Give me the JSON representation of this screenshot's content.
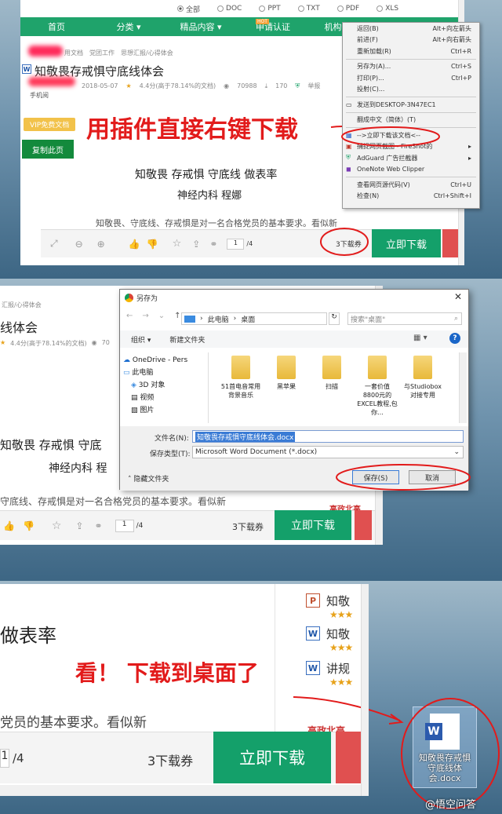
{
  "panel1": {
    "formats": [
      "全部",
      "DOC",
      "PPT",
      "TXT",
      "PDF",
      "XLS"
    ],
    "nav": [
      "首页",
      "分类 ▾",
      "精品内容 ▾",
      "申请认证",
      "机构合作 ▾"
    ],
    "hot_badge": "HOT",
    "breadcrumb": [
      "用文档",
      "党团工作",
      "思想汇报/心得体会"
    ],
    "doc_title": "知敬畏存戒惧守底线体会",
    "date": "2018-05-07",
    "rating": "4.4分(高于78.14%的文档)",
    "views": "70988",
    "downloads": "170",
    "report": "举报",
    "phone_read": "手机阅",
    "vip_label": "VIP免费文档",
    "copy_button": "复制此页",
    "content_title": "知敬畏 存戒惧 守底线 做表率",
    "author": "神经内科 程娜",
    "body_text": "知敬畏、守底线、存戒惧是对一名合格党员的基本要求。看似新",
    "page_current": "1",
    "page_total": "/4",
    "download_ticket": "3下载券",
    "download_now": "立即下载",
    "annotation": "用插件直接右键下载"
  },
  "context_menu": {
    "items": [
      {
        "label": "返回(B)",
        "shortcut": "Alt+向左箭头"
      },
      {
        "label": "前进(F)",
        "shortcut": "Alt+向右箭头"
      },
      {
        "label": "重新加载(R)",
        "shortcut": "Ctrl+R"
      },
      {
        "sep": true
      },
      {
        "label": "另存为(A)...",
        "shortcut": "Ctrl+S"
      },
      {
        "label": "打印(P)...",
        "shortcut": "Ctrl+P"
      },
      {
        "label": "投射(C)...",
        "shortcut": ""
      },
      {
        "sep": true
      },
      {
        "label": "发送到DESKTOP-3N47EC1",
        "shortcut": ""
      },
      {
        "sep": true
      },
      {
        "label": "翻成中文（简体）(T)",
        "shortcut": ""
      },
      {
        "sep": true
      },
      {
        "label": "-->立即下载该文档<--",
        "shortcut": ""
      },
      {
        "label": "捕捉网页截图 - FireShot的",
        "shortcut": "▸"
      },
      {
        "label": "AdGuard 广告拦截器",
        "shortcut": "▸"
      },
      {
        "label": "OneNote Web Clipper",
        "shortcut": ""
      },
      {
        "sep": true
      },
      {
        "label": "查看网页源代码(V)",
        "shortcut": "Ctrl+U"
      },
      {
        "label": "检查(N)",
        "shortcut": "Ctrl+Shift+I"
      }
    ]
  },
  "panel2": {
    "breadcrumb": "汇报/心得体会",
    "doc_title_partial": "线体会",
    "rating": "4.4分(高于78.14%的文档)",
    "views_partial": "70",
    "content_title_partial": "知敬畏 存戒惧 守底",
    "author_partial": "神经内科 程",
    "body_partial": "守底线、存戒惧是对一名合格党员的基本要求。看似新",
    "side_text": "高政北高",
    "page_current": "1",
    "page_total": "/4",
    "download_ticket": "3下载券",
    "download_now": "立即下载"
  },
  "save_dialog": {
    "title": "另存为",
    "path": [
      "此电脑",
      "桌面"
    ],
    "search_placeholder": "搜索\"桌面\"",
    "organize": "组织 ▾",
    "new_folder": "新建文件夹",
    "sidebar": [
      "OneDrive - Pers",
      "此电脑",
      "3D 对象",
      "视频",
      "图片"
    ],
    "files": [
      "51首电音常用背景音乐",
      "黑苹果",
      "扫描",
      "一套价值8800元的EXCEL教程,包你...",
      "与Studiobox对接专用"
    ],
    "filename_label": "文件名(N):",
    "filename": "知敬畏存戒惧守底线体会.docx",
    "filetype_label": "保存类型(T):",
    "filetype": "Microsoft Word Document (*.docx)",
    "hide_folders": "隐藏文件夹",
    "save": "保存(S)",
    "cancel": "取消"
  },
  "panel3": {
    "content_partial": "做表率",
    "body_partial": "党员的基本要求。看似新",
    "side_docs": [
      "知敬",
      "知敬",
      "讲规"
    ],
    "side_text": "高政北高",
    "page_current": "1",
    "page_total": "/4",
    "download_ticket": "3下载券",
    "download_now": "立即下载",
    "annotation": "看！ 下载到桌面了",
    "desktop_file": "知敬畏存戒惧守底线体会.docx",
    "watermark": "@悟空问答"
  }
}
